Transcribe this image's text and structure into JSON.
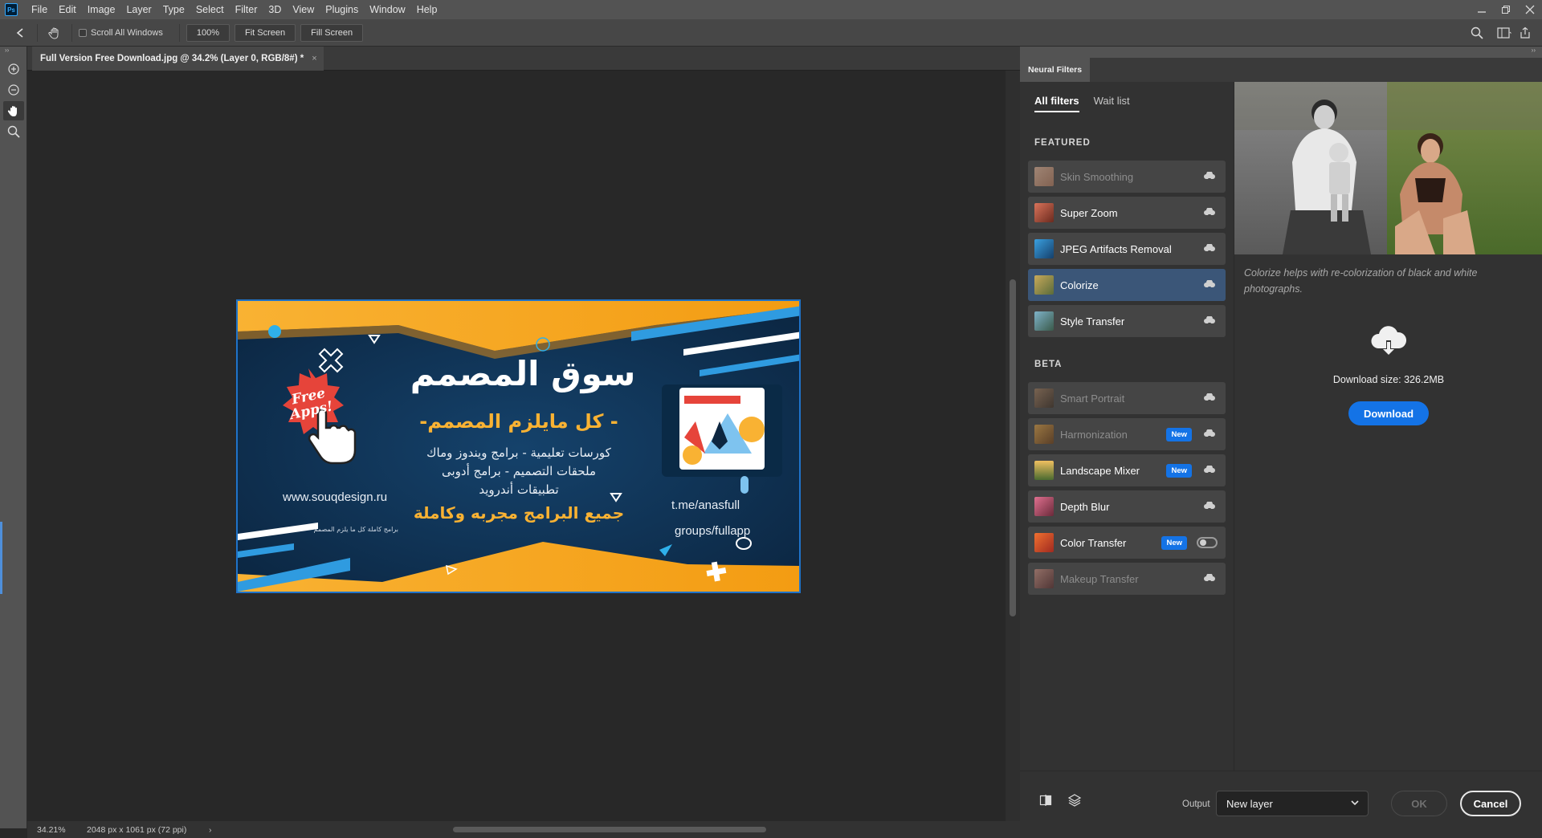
{
  "app": {
    "logo": "Ps"
  },
  "menu": [
    "File",
    "Edit",
    "Image",
    "Layer",
    "Type",
    "Select",
    "Filter",
    "3D",
    "View",
    "Plugins",
    "Window",
    "Help"
  ],
  "options_bar": {
    "scroll_all_windows": "Scroll All Windows",
    "zoom_value": "100%",
    "fit_screen": "Fit Screen",
    "fill_screen": "Fill Screen"
  },
  "document": {
    "tab_title": "Full Version Free Download.jpg @ 34.2% (Layer 0, RGB/8#) *",
    "tab_close": "×",
    "artwork": {
      "title": "سوق المصمم",
      "subtitle": "- كل مايلزم المصمم-",
      "line1": "كورسات تعليمية - برامج ويندوز وماك",
      "line2": "ملحقات التصميم - برامج أدوبى",
      "line3": "تطبيقات أندرويد",
      "line4": "جميع البرامج مجربه وكاملة",
      "badge": "Free Apps!",
      "website": "www.souqdesign.ru",
      "small_text": "برامج كاملة كل ما يلزم المصمم",
      "telegram1": "t.me/anasfull",
      "telegram2": "groups/fullapp"
    }
  },
  "status": {
    "zoom": "34.21%",
    "doc_size": "2048 px x 1061 px (72 ppi)"
  },
  "neural_filters": {
    "panel_tab": "Neural Filters",
    "subtabs": {
      "all": "All filters",
      "wait": "Wait list"
    },
    "featured_label": "FEATURED",
    "beta_label": "BETA",
    "featured": [
      {
        "name": "Skin Smoothing",
        "badge": ""
      },
      {
        "name": "Super Zoom",
        "badge": ""
      },
      {
        "name": "JPEG Artifacts Removal",
        "badge": ""
      },
      {
        "name": "Colorize",
        "badge": ""
      },
      {
        "name": "Style Transfer",
        "badge": ""
      }
    ],
    "beta": [
      {
        "name": "Smart Portrait",
        "badge": ""
      },
      {
        "name": "Harmonization",
        "badge": "New"
      },
      {
        "name": "Landscape Mixer",
        "badge": "New"
      },
      {
        "name": "Depth Blur",
        "badge": ""
      },
      {
        "name": "Color Transfer",
        "badge": "New"
      },
      {
        "name": "Makeup Transfer",
        "badge": ""
      }
    ],
    "detail": {
      "description": "Colorize helps with re-colorization of black and white photographs.",
      "download_size": "Download size: 326.2MB",
      "download_button": "Download"
    },
    "footer": {
      "output_label": "Output",
      "output_value": "New layer",
      "ok": "OK",
      "cancel": "Cancel"
    }
  },
  "colors": {
    "accent": "#1473e6",
    "selected_row": "#3b5678",
    "panel_bg": "#323232",
    "chrome_bg": "#535353"
  }
}
